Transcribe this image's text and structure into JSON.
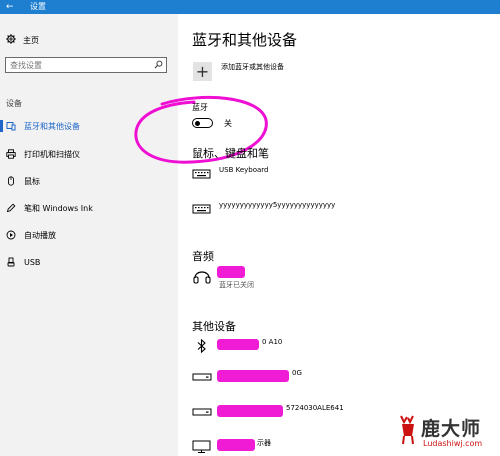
{
  "window": {
    "title": "设置",
    "back_glyph": "←"
  },
  "sidebar": {
    "home_label": "主页",
    "search_placeholder": "查找设置",
    "section_label": "设备",
    "items": [
      {
        "label": "蓝牙和其他设备",
        "icon": "bluetooth-devices-icon",
        "active": true
      },
      {
        "label": "打印机和扫描仪",
        "icon": "printer-icon"
      },
      {
        "label": "鼠标",
        "icon": "mouse-icon"
      },
      {
        "label": "笔和 Windows Ink",
        "icon": "pen-icon"
      },
      {
        "label": "自动播放",
        "icon": "autoplay-icon"
      },
      {
        "label": "USB",
        "icon": "usb-icon"
      }
    ]
  },
  "main": {
    "title": "蓝牙和其他设备",
    "add_device_label": "添加蓝牙或其他设备",
    "bluetooth": {
      "label": "蓝牙",
      "state": "关",
      "on": false
    },
    "mouse_keyboard": {
      "heading": "鼠标、键盘和笔",
      "devices": [
        {
          "name": "USB Keyboard",
          "icon": "keyboard-icon"
        },
        {
          "name": "yyyyyyyyyyyyy5yyyyyyyyyyyyyy",
          "icon": "keyboard-icon"
        }
      ]
    },
    "audio": {
      "heading": "音频",
      "devices": [
        {
          "name": "",
          "status": "蓝牙已关闭",
          "icon": "headset-icon"
        }
      ]
    },
    "other": {
      "heading": "其他设备",
      "devices": [
        {
          "name": "0 A10",
          "icon": "bluetooth-icon"
        },
        {
          "name": "0G",
          "icon": "drive-icon"
        },
        {
          "name": "5724030ALE641",
          "icon": "drive-icon"
        },
        {
          "name": "示器",
          "icon": "monitor-icon"
        }
      ]
    }
  },
  "watermark": {
    "text": "鹿大师",
    "sub": "Ludashiwj.com"
  },
  "colors": {
    "accent": "#1e66c7",
    "titlebar": "#1e7fd1",
    "sidebar_bg": "#f2f2f2",
    "annotation": "#ef0fd3"
  }
}
